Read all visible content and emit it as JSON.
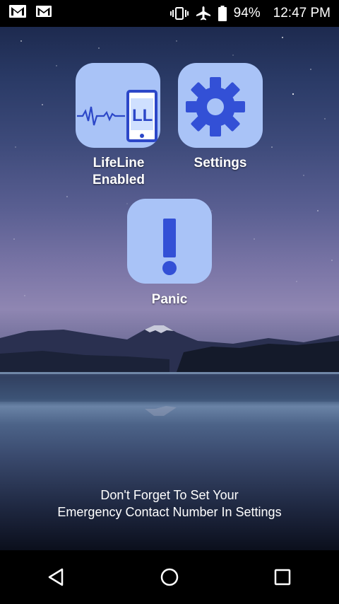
{
  "status_bar": {
    "left_icons": [
      "gmail-icon",
      "gmail-icon"
    ],
    "right_icons": [
      "vibrate-icon",
      "airplane-icon",
      "battery-icon"
    ],
    "battery": "94%",
    "time": "12:47 PM"
  },
  "tiles": {
    "lifeline": {
      "label_line1": "LifeLine",
      "label_line2": "Enabled",
      "logo_text": "LL",
      "icon": "heartbeat-phone-icon"
    },
    "settings": {
      "label": "Settings",
      "icon": "gear-icon"
    },
    "panic": {
      "label": "Panic",
      "icon": "exclamation-icon"
    }
  },
  "message": {
    "line1": "Don't Forget To Set Your",
    "line2": "Emergency Contact Number In Settings"
  },
  "nav_bar": {
    "icons": [
      "back-icon",
      "home-icon",
      "recents-icon"
    ]
  },
  "colors": {
    "tile_bg": "#a9c3f7",
    "icon_blue": "#3350d6",
    "status_bg": "#000000"
  }
}
